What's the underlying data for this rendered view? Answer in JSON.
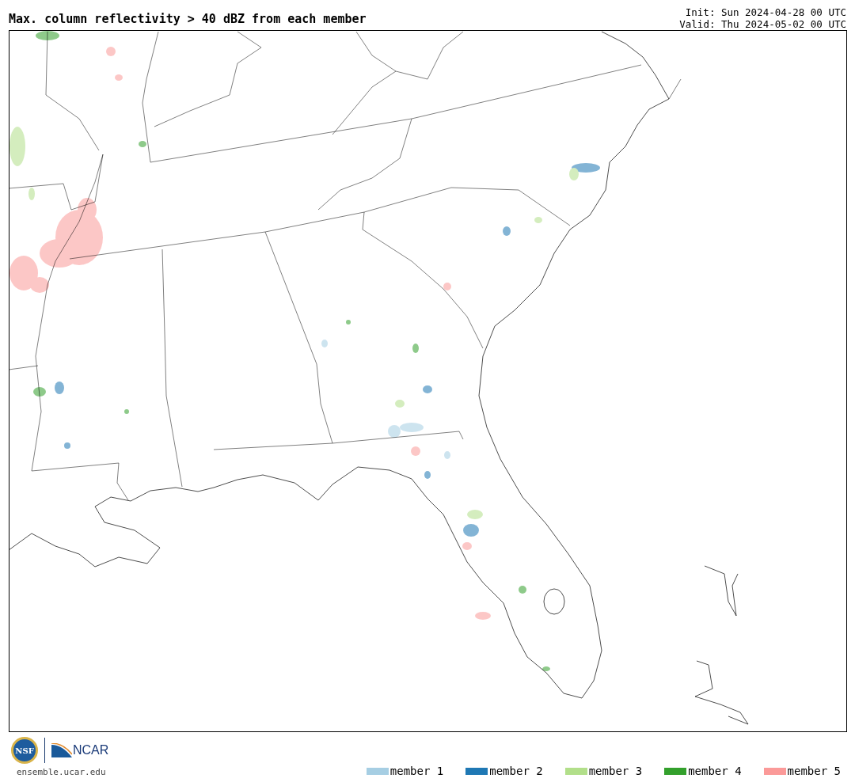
{
  "title": "Max. column reflectivity > 40 dBZ from each member",
  "run_info": [
    "Init: Sun 2024-04-28 00 UTC",
    "Valid: Thu 2024-05-02 00 UTC"
  ],
  "logos": [
    "NSF",
    "NCAR"
  ],
  "website": "ensemble.ucar.edu",
  "legend": [
    {
      "label": "member 1",
      "color": "#a6cee3"
    },
    {
      "label": "member 2",
      "color": "#1f78b4"
    },
    {
      "label": "member 3",
      "color": "#b2df8a"
    },
    {
      "label": "member 4",
      "color": "#33a02c"
    },
    {
      "label": "member 5",
      "color": "#fb9a99"
    }
  ]
}
